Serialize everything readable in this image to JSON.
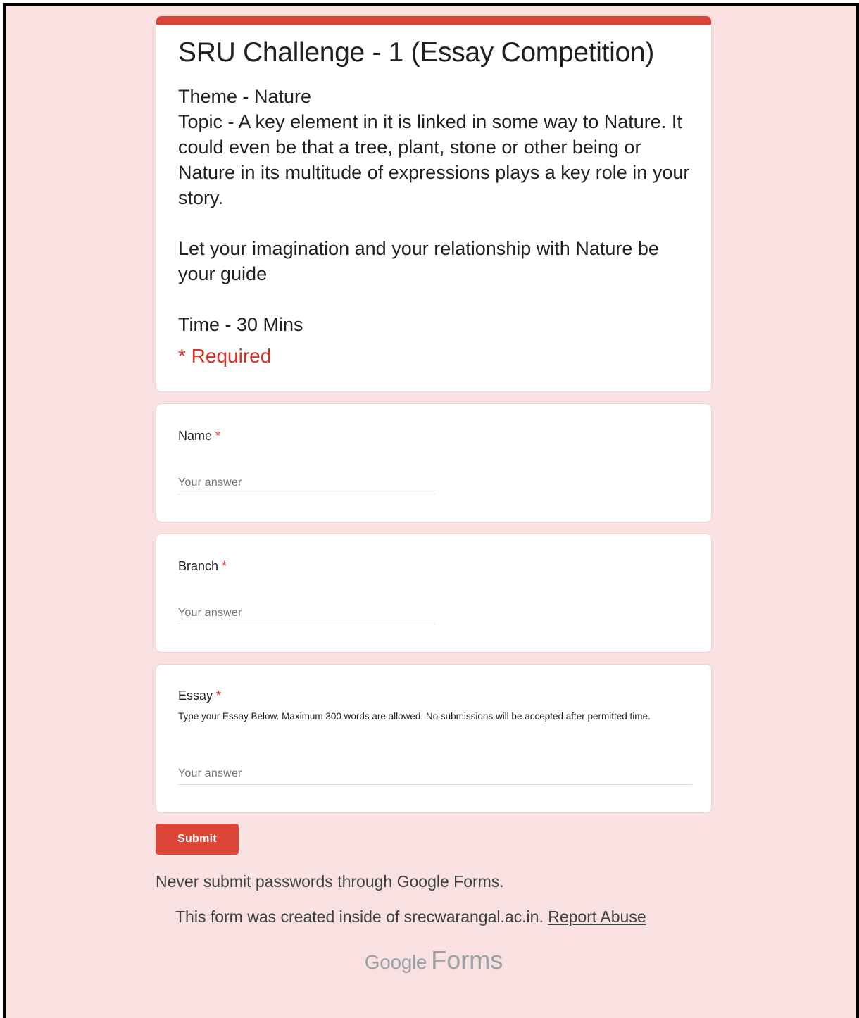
{
  "form": {
    "title": "SRU Challenge - 1 (Essay Competition)",
    "description": [
      "Theme - Nature",
      "Topic - A key element in it is linked in some way to Nature. It could even be that a tree, plant, stone or other being or Nature in its multitude of expressions plays a key role in your story.",
      "",
      "Let your imagination and your relationship with Nature be your guide",
      "",
      "Time - 30 Mins"
    ],
    "required_note": "* Required",
    "accent_color": "#db4437",
    "background_color": "#f8e1e0"
  },
  "questions": [
    {
      "label": "Name",
      "required_mark": "*",
      "placeholder": "Your answer"
    },
    {
      "label": "Branch",
      "required_mark": "*",
      "placeholder": "Your answer"
    },
    {
      "label": "Essay",
      "required_mark": "*",
      "help": "Type your Essay Below. Maximum 300 words are allowed. No submissions will be accepted after permitted time.",
      "placeholder": "Your answer"
    }
  ],
  "submit_label": "Submit",
  "footer": {
    "password_warning": "Never submit passwords through Google Forms.",
    "created_text": "This form was created inside of srecwarangal.ac.in.",
    "report_link": "Report Abuse",
    "brand_google": "Google",
    "brand_forms": "Forms"
  }
}
